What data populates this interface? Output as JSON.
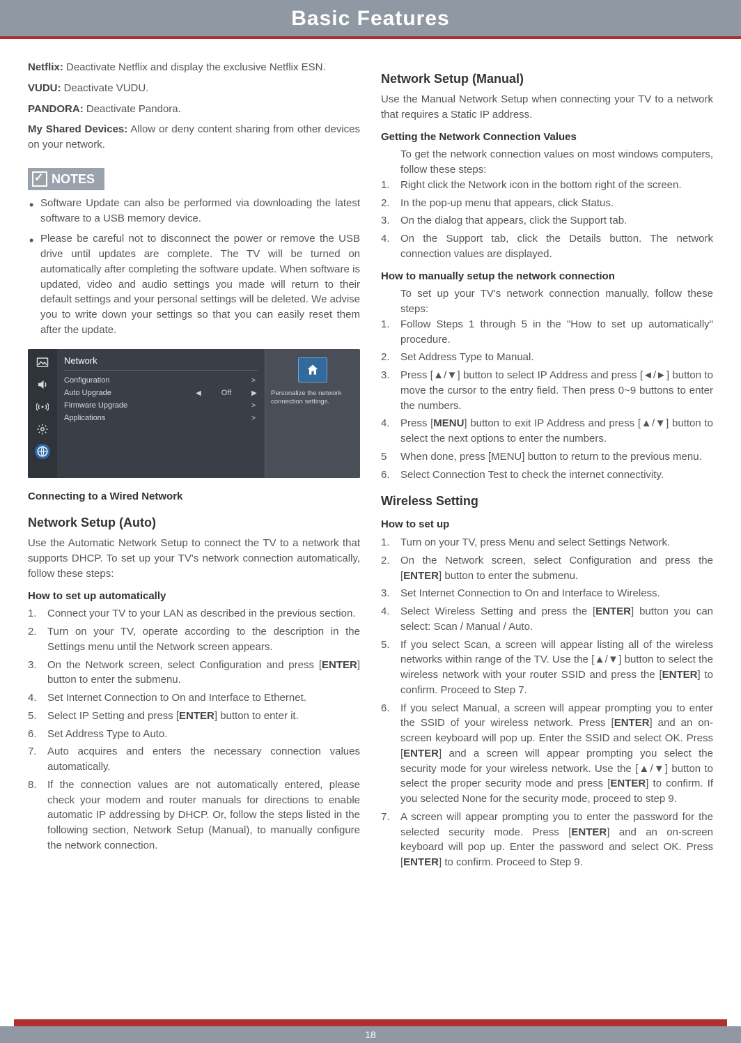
{
  "header": {
    "title": "Basic Features"
  },
  "page_number": "18",
  "left": {
    "intro": [
      {
        "label": "Netflix:",
        "text": " Deactivate Netflix and display the exclusive Netflix ESN."
      },
      {
        "label": "VUDU:",
        "text": " Deactivate VUDU."
      },
      {
        "label": "PANDORA:",
        "text": " Deactivate Pandora."
      },
      {
        "label": "My Shared Devices:",
        "text": " Allow or deny content sharing from other devices on your network."
      }
    ],
    "notes_label": "NOTES",
    "notes": [
      "Software Update can also be performed via downloading the latest software to a USB memory device.",
      "Please be careful not to disconnect the power or remove the USB drive until updates are complete. The TV will be turned on automatically after completing the software update. When software is updated, video and audio settings you made will return to their default settings and your personal settings will be deleted. We advise you to write down your settings so that you can easily reset them after the update."
    ],
    "menu": {
      "title": "Network",
      "rows": [
        {
          "label": "Configuration",
          "value": "",
          "arrow": ">"
        },
        {
          "label": "Auto Upgrade",
          "value": "Off",
          "arrow": ">",
          "slider": true
        },
        {
          "label": "Firmware Upgrade",
          "value": "",
          "arrow": ">"
        },
        {
          "label": "Applications",
          "value": "",
          "arrow": ">"
        }
      ],
      "rightDesc": "Personalize the network connection settings."
    },
    "connecting_h": "Connecting to a Wired Network",
    "auto_h": "Network Setup (Auto)",
    "auto_p": "Use the Automatic Network Setup to connect the TV to a network that supports DHCP. To set up your TV's network connection automatically, follow these steps:",
    "auto_sub": "How to set up automatically",
    "auto_steps": [
      "Connect your TV to your LAN as described in the previous section.",
      "Turn on your TV, operate according to the description in the Settings menu until the Network screen appears.",
      {
        "pre": "On the Network screen, select Configuration and press [",
        "b": "ENTER",
        "post": "] button to enter the submenu."
      },
      "Set Internet Connection to On and Interface to Ethernet.",
      {
        "pre": "Select IP Setting and press [",
        "b": "ENTER",
        "post": "] button to enter it."
      },
      "Set Address Type to Auto.",
      "Auto acquires and enters the necessary connection values automatically.",
      "If the connection values are not automatically entered, please check your modem and router manuals for directions to enable automatic IP addressing by DHCP. Or, follow the steps listed in the following section, Network Setup (Manual), to manually configure the network connection."
    ]
  },
  "right": {
    "manual_h": "Network Setup (Manual)",
    "manual_p": "Use the Manual Network Setup when connecting your TV to a network that requires a Static IP address.",
    "gcv_h": "Getting the Network Connection Values",
    "gcv_intro": "To get the network connection values on most windows computers, follow these steps:",
    "gcv_steps": [
      "Right click the Network icon in the bottom right of the screen.",
      "In the pop-up menu that appears, click Status.",
      "On the dialog that appears, click the Support tab.",
      "On the Support tab, click the Details button. The network connection values are displayed."
    ],
    "man_h": "How to manually setup the network connection",
    "man_intro": "To set up your TV's network connection manually, follow these steps:",
    "man_steps": [
      "Follow Steps 1 through 5 in the \"How to set up automatically\" procedure.",
      "Set Address Type to Manual.",
      "Press [▲/▼] button to select IP Address and press [◄/►] button to move the cursor to the entry field. Then press 0~9 buttons to enter the numbers.",
      {
        "pre": "Press [",
        "b": "MENU",
        "post": "] button to exit IP Address and press [▲/▼] button to select the next options to enter the numbers."
      },
      "When done, press [MENU] button to return to the previous menu.",
      "Select Connection Test to check the internet connectivity."
    ],
    "wireless_h": "Wireless Setting",
    "wireless_sub": "How to set up",
    "wireless_steps": [
      "Turn on your TV, press Menu and select Settings  Network.",
      {
        "pre": "On the Network screen, select Configuration and press the [",
        "b": "ENTER",
        "post": "] button to enter the submenu."
      },
      "Set Internet Connection to On and Interface to Wireless.",
      {
        "pre": "Select Wireless Setting and press the [",
        "b": "ENTER",
        "post": "] button you can select: Scan / Manual / Auto."
      },
      {
        "pre": "If you select Scan, a screen will appear listing all of the wireless networks within range of the TV. Use the [▲/▼] button to select the wireless network with your router SSID and press the [",
        "b": "ENTER",
        "post": "] to confirm. Proceed to Step 7."
      },
      {
        "parts": [
          {
            "t": "If you select Manual, a screen will appear prompting you to enter the SSID of your wireless network. Press ["
          },
          {
            "b": "ENTER"
          },
          {
            "t": "] and an on-screen keyboard will pop up. Enter the SSID and select OK. Press ["
          },
          {
            "b": "ENTER"
          },
          {
            "t": "] and a screen will appear prompting you select the security mode for your wireless network. Use the [▲/▼] button to select the proper security mode and press ["
          },
          {
            "b": "ENTER"
          },
          {
            "t": "] to confirm. If you selected None for the security mode, proceed to step 9."
          }
        ]
      },
      {
        "parts": [
          {
            "t": "A screen will appear prompting you to enter the password for the selected security mode. Press ["
          },
          {
            "b": "ENTER"
          },
          {
            "t": "] and an on-screen keyboard will pop up. Enter the password and select OK. Press ["
          },
          {
            "b": "ENTER"
          },
          {
            "t": "] to confirm. Proceed to Step 9."
          }
        ]
      }
    ]
  }
}
